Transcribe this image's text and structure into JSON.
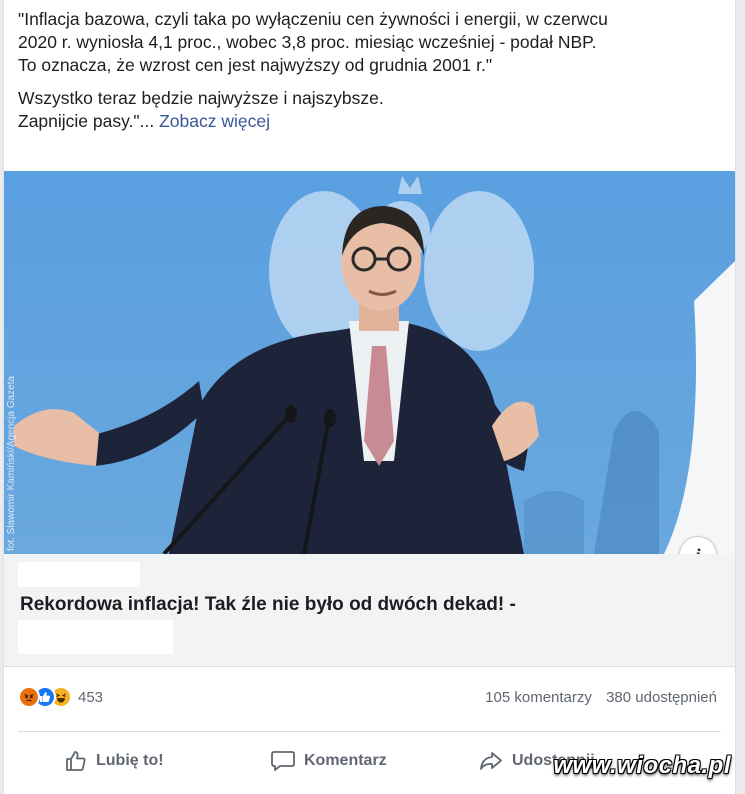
{
  "post": {
    "text_lines_1": [
      "\"Inflacja bazowa, czyli taka po wyłączeniu cen żywności i energii, w czerwcu",
      "2020 r. wyniosła 4,1 proc., wobec 3,8 proc. miesiąc wcześniej - podał NBP.",
      "To oznacza, że wzrost cen jest najwyższy od grudnia 2001 r.\""
    ],
    "text_line_2": "Wszystko teraz będzie najwyższe i najszybsze.",
    "text_line_3": "Zapnijcie pasy.\"...",
    "see_more": "Zobacz więcej"
  },
  "image": {
    "credit": "fot. Sławomir Kamiński/Agencja Gazeta",
    "info_icon": "i"
  },
  "link": {
    "headline": "Rekordowa inflacja! Tak źle nie było od dwóch dekad! -"
  },
  "stats": {
    "reaction_icons": [
      "angry-icon",
      "like-icon",
      "haha-icon"
    ],
    "reaction_count": "453",
    "comments": "105 komentarzy",
    "shares": "380 udostępnień"
  },
  "actions": {
    "like": "Lubię to!",
    "comment": "Komentarz",
    "share": "Udostępnij"
  },
  "watermark": "www.wiocha.pl",
  "colors": {
    "link": "#385898",
    "photo_bg": "#5fa0dc",
    "suit": "#1d2338",
    "tie": "#c98b93",
    "angry": "#e9710f",
    "like": "#1877f2",
    "haha": "#f7b125"
  }
}
